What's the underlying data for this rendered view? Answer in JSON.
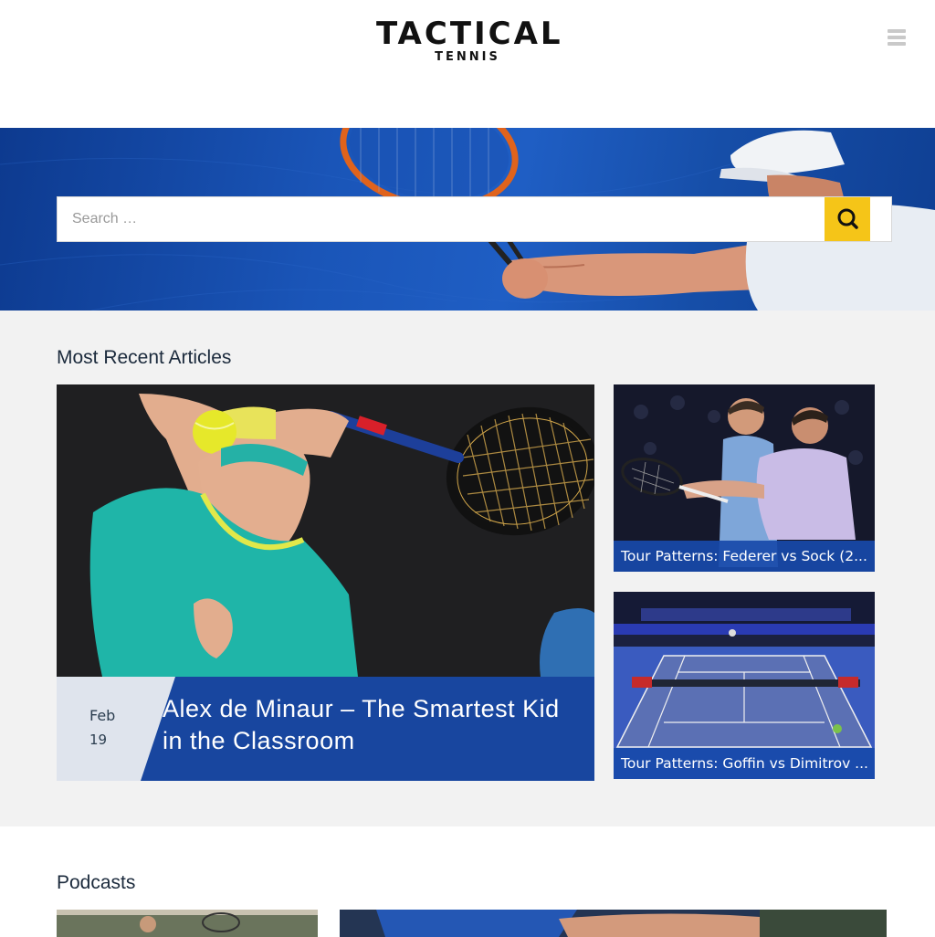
{
  "header": {
    "logo_main": "TACTICAL",
    "logo_sub": "TENNIS",
    "menu_icon": "hamburger-menu-icon"
  },
  "search": {
    "placeholder": "Search …",
    "button_icon": "search-icon",
    "button_color": "#f5c518"
  },
  "recent": {
    "title": "Most Recent Articles",
    "featured": {
      "month": "Feb",
      "day": "19",
      "title": "Alex de Minaur – The Smartest Kid in the Classroom"
    },
    "cards": [
      {
        "title": "Tour Patterns: Federer vs Sock (2..."
      },
      {
        "title": "Tour Patterns: Goffin vs Dimitrov ..."
      }
    ]
  },
  "podcasts": {
    "title": "Podcasts"
  },
  "colors": {
    "accent_yellow": "#f5c518",
    "caption_blue": "#184aaa",
    "section_bg": "#f2f2f2",
    "heading": "#1b2a3c"
  }
}
